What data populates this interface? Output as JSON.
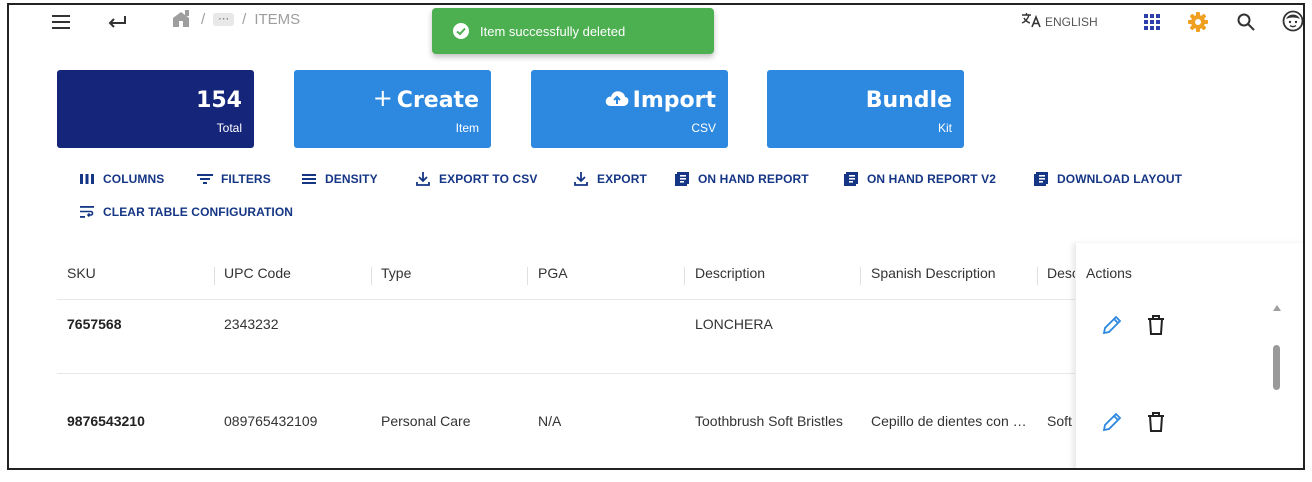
{
  "breadcrumb": {
    "more": "⋯",
    "separator": "/",
    "current": "ITEMS"
  },
  "snackbar": {
    "message": "Item successfully deleted",
    "color": "#4caf50"
  },
  "language": {
    "icon": "translate-icon",
    "label": "ENGLISH"
  },
  "topbar_icons": [
    "menu-icon",
    "back-arrow-icon",
    "home-icon",
    "apps-icon",
    "gear-icon",
    "search-icon",
    "avatar-icon"
  ],
  "cards": {
    "total": {
      "value": "154",
      "label": "Total",
      "color": "#15257a"
    },
    "create": {
      "prefix": "+",
      "title": "Create",
      "subtitle": "Item",
      "icon": "plus-icon"
    },
    "import": {
      "title": "Import",
      "subtitle": "CSV",
      "icon": "cloud-upload-icon"
    },
    "bundle": {
      "title": "Bundle",
      "subtitle": "Kit"
    },
    "button_color": "#2d88e0"
  },
  "toolbar": {
    "columns": "COLUMNS",
    "filters": "FILTERS",
    "density": "DENSITY",
    "export_csv": "EXPORT TO CSV",
    "export": "EXPORT",
    "on_hand_report": "ON HAND REPORT",
    "on_hand_report_v2": "ON HAND REPORT V2",
    "download_layout": "DOWNLOAD LAYOUT",
    "clear_config": "CLEAR TABLE CONFIGURATION",
    "color": "#153585"
  },
  "table": {
    "columns": [
      "SKU",
      "UPC Code",
      "Type",
      "PGA",
      "Description",
      "Spanish Description",
      "Desc",
      "Actions"
    ],
    "rows": [
      {
        "sku": "7657568",
        "upc": "2343232",
        "type": "",
        "pga": "",
        "description": "LONCHERA",
        "spanish": "",
        "desc": ""
      },
      {
        "sku": "9876543210",
        "upc": "089765432109",
        "type": "Personal Care",
        "pga": "N/A",
        "description": "Toothbrush Soft Bristles",
        "spanish": "Cepillo de dientes con …",
        "desc": "Soft"
      }
    ],
    "row_action_icons": [
      "edit-pencil-icon",
      "delete-trash-icon"
    ]
  }
}
